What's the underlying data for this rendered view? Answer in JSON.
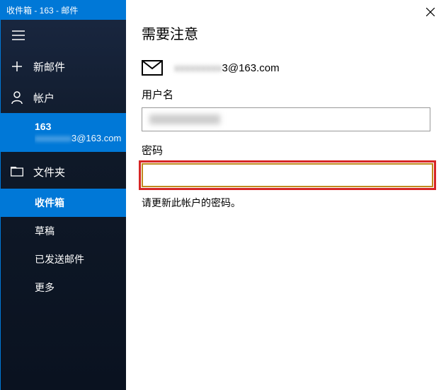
{
  "titlebar": {
    "text": "收件箱 - 163 - 邮件"
  },
  "sidebar": {
    "new_mail": "新邮件",
    "accounts": "帐户",
    "folders": "文件夹",
    "account": {
      "name": "163",
      "email_suffix": "3@163.com"
    },
    "folder_items": {
      "inbox": "收件箱",
      "drafts": "草稿",
      "sent": "已发送邮件",
      "more": "更多"
    }
  },
  "dialog": {
    "heading": "需要注意",
    "email_suffix": "3@163.com",
    "username_label": "用户名",
    "password_label": "密码",
    "help_text": "请更新此帐户的密码。"
  }
}
